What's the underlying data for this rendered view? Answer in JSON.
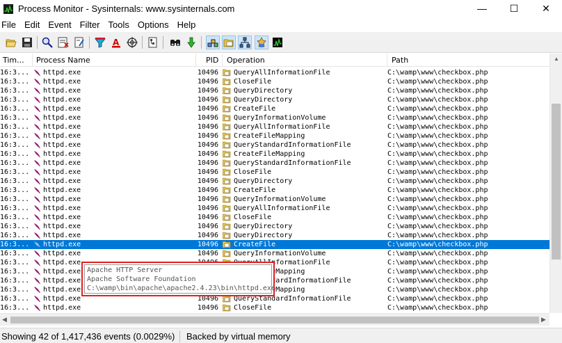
{
  "window": {
    "title": "Process Monitor - Sysinternals: www.sysinternals.com",
    "minimize_glyph": "—",
    "maximize_glyph": "☐",
    "close_glyph": "✕"
  },
  "menu": [
    "File",
    "Edit",
    "Event",
    "Filter",
    "Tools",
    "Options",
    "Help"
  ],
  "toolbar": {
    "buttons": [
      {
        "name": "open-icon"
      },
      {
        "name": "save-icon"
      },
      {
        "name": "magnify-icon"
      },
      {
        "name": "autoscroll-icon"
      },
      {
        "name": "clear-icon"
      },
      {
        "name": "filter-icon"
      },
      {
        "name": "highlight-icon"
      },
      {
        "name": "target-icon"
      },
      {
        "name": "process-tree-icon"
      },
      {
        "name": "find-icon"
      },
      {
        "name": "jump-icon"
      },
      {
        "name": "registry-activity-icon"
      },
      {
        "name": "filesystem-activity-icon"
      },
      {
        "name": "network-activity-icon"
      },
      {
        "name": "process-activity-icon"
      },
      {
        "name": "profiling-activity-icon"
      }
    ]
  },
  "columns": {
    "time": "Tim...",
    "process": "Process Name",
    "pid": "PID",
    "operation": "Operation",
    "path": "Path"
  },
  "rows": [
    {
      "time": "16:3...",
      "process": "httpd.exe",
      "pid": "10496",
      "operation": "QueryAllInformationFile",
      "path": "C:\\wamp\\www\\checkbox.php"
    },
    {
      "time": "16:3...",
      "process": "httpd.exe",
      "pid": "10496",
      "operation": "CloseFile",
      "path": "C:\\wamp\\www\\checkbox.php"
    },
    {
      "time": "16:3...",
      "process": "httpd.exe",
      "pid": "10496",
      "operation": "QueryDirectory",
      "path": "C:\\wamp\\www\\checkbox.php"
    },
    {
      "time": "16:3...",
      "process": "httpd.exe",
      "pid": "10496",
      "operation": "QueryDirectory",
      "path": "C:\\wamp\\www\\checkbox.php"
    },
    {
      "time": "16:3...",
      "process": "httpd.exe",
      "pid": "10496",
      "operation": "CreateFile",
      "path": "C:\\wamp\\www\\checkbox.php"
    },
    {
      "time": "16:3...",
      "process": "httpd.exe",
      "pid": "10496",
      "operation": "QueryInformationVolume",
      "path": "C:\\wamp\\www\\checkbox.php"
    },
    {
      "time": "16:3...",
      "process": "httpd.exe",
      "pid": "10496",
      "operation": "QueryAllInformationFile",
      "path": "C:\\wamp\\www\\checkbox.php"
    },
    {
      "time": "16:3...",
      "process": "httpd.exe",
      "pid": "10496",
      "operation": "CreateFileMapping",
      "path": "C:\\wamp\\www\\checkbox.php"
    },
    {
      "time": "16:3...",
      "process": "httpd.exe",
      "pid": "10496",
      "operation": "QueryStandardInformationFile",
      "path": "C:\\wamp\\www\\checkbox.php"
    },
    {
      "time": "16:3...",
      "process": "httpd.exe",
      "pid": "10496",
      "operation": "CreateFileMapping",
      "path": "C:\\wamp\\www\\checkbox.php"
    },
    {
      "time": "16:3...",
      "process": "httpd.exe",
      "pid": "10496",
      "operation": "QueryStandardInformationFile",
      "path": "C:\\wamp\\www\\checkbox.php"
    },
    {
      "time": "16:3...",
      "process": "httpd.exe",
      "pid": "10496",
      "operation": "CloseFile",
      "path": "C:\\wamp\\www\\checkbox.php"
    },
    {
      "time": "16:3...",
      "process": "httpd.exe",
      "pid": "10496",
      "operation": "QueryDirectory",
      "path": "C:\\wamp\\www\\checkbox.php"
    },
    {
      "time": "16:3...",
      "process": "httpd.exe",
      "pid": "10496",
      "operation": "CreateFile",
      "path": "C:\\wamp\\www\\checkbox.php"
    },
    {
      "time": "16:3...",
      "process": "httpd.exe",
      "pid": "10496",
      "operation": "QueryInformationVolume",
      "path": "C:\\wamp\\www\\checkbox.php"
    },
    {
      "time": "16:3...",
      "process": "httpd.exe",
      "pid": "10496",
      "operation": "QueryAllInformationFile",
      "path": "C:\\wamp\\www\\checkbox.php"
    },
    {
      "time": "16:3...",
      "process": "httpd.exe",
      "pid": "10496",
      "operation": "CloseFile",
      "path": "C:\\wamp\\www\\checkbox.php"
    },
    {
      "time": "16:3...",
      "process": "httpd.exe",
      "pid": "10496",
      "operation": "QueryDirectory",
      "path": "C:\\wamp\\www\\checkbox.php"
    },
    {
      "time": "16:3...",
      "process": "httpd.exe",
      "pid": "10496",
      "operation": "QueryDirectory",
      "path": "C:\\wamp\\www\\checkbox.php"
    },
    {
      "time": "16:3...",
      "process": "httpd.exe",
      "pid": "10496",
      "operation": "CreateFile",
      "path": "C:\\wamp\\www\\checkbox.php",
      "selected": true
    },
    {
      "time": "16:3...",
      "process": "httpd.exe",
      "pid": "10496",
      "operation": "QueryInformationVolume",
      "path": "C:\\wamp\\www\\checkbox.php"
    },
    {
      "time": "16:3...",
      "process": "httpd.exe",
      "pid": "10496",
      "operation": "QueryAllInformationFile",
      "path": "C:\\wamp\\www\\checkbox.php"
    },
    {
      "time": "16:3...",
      "process": "httpd.exe",
      "pid": "10496",
      "operation": "CreateFileMapping",
      "path": "C:\\wamp\\www\\checkbox.php"
    },
    {
      "time": "16:3...",
      "process": "httpd.exe",
      "pid": "10496",
      "operation": "QueryStandardInformationFile",
      "path": "C:\\wamp\\www\\checkbox.php"
    },
    {
      "time": "16:3...",
      "process": "httpd.exe",
      "pid": "10496",
      "operation": "CreateFileMapping",
      "path": "C:\\wamp\\www\\checkbox.php"
    },
    {
      "time": "16:3...",
      "process": "httpd.exe",
      "pid": "10496",
      "operation": "QueryStandardInformationFile",
      "path": "C:\\wamp\\www\\checkbox.php"
    },
    {
      "time": "16:3...",
      "process": "httpd.exe",
      "pid": "10496",
      "operation": "CloseFile",
      "path": "C:\\wamp\\www\\checkbox.php"
    }
  ],
  "tooltip": {
    "line1": "Apache HTTP Server",
    "line2": "Apache Software Foundation",
    "line3": "C:\\wamp\\bin\\apache\\apache2.4.23\\bin\\httpd.exe"
  },
  "status": {
    "events": "Showing 42 of 1,417,436 events (0.0029%)",
    "memory": "Backed by virtual memory"
  },
  "colors": {
    "selection": "#0078d7",
    "tooltip_border": "#e02020"
  }
}
